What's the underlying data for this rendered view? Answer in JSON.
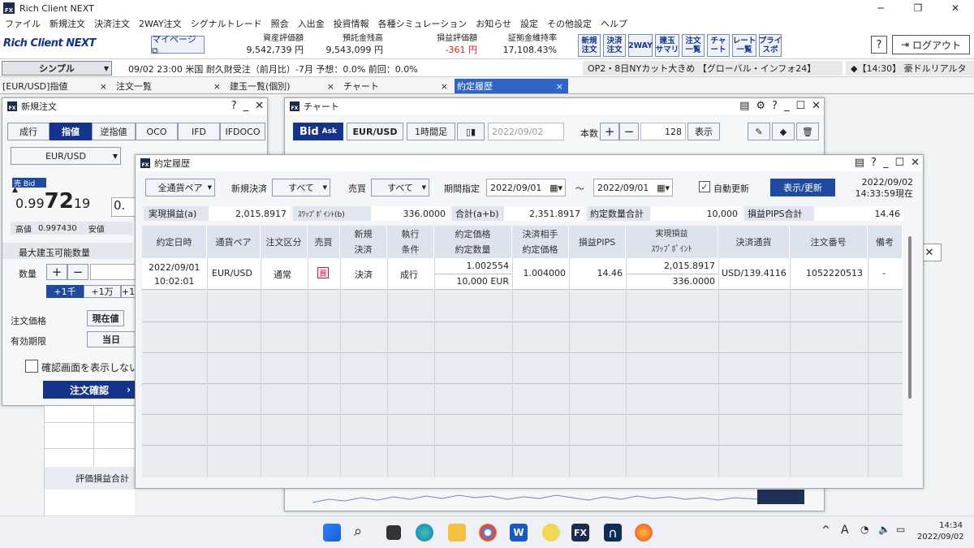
{
  "app": {
    "title": "Rich Client NEXT",
    "fx": "FX"
  },
  "window_controls": {
    "minimize": "─",
    "restore": "❐",
    "close": "✕"
  },
  "menu": [
    "ファイル",
    "新規注文",
    "決済注文",
    "2WAY注文",
    "シグナルトレード",
    "照会",
    "入出金",
    "投資情報",
    "各種シミュレーション",
    "お知らせ",
    "設定",
    "その他設定",
    "ヘルプ"
  ],
  "header": {
    "logo": "Rich Client NEXT",
    "mypage": "マイページ ⧉",
    "stats": [
      {
        "label": "資産評価額",
        "value": "9,542,739 円",
        "color": "#222222"
      },
      {
        "label": "預託金残高",
        "value": "9,543,099 円",
        "color": "#222222"
      },
      {
        "label": "損益評価額",
        "value": "-361 円",
        "color": "#e01b1b"
      },
      {
        "label": "証拠金維持率",
        "value": "17,108.43%",
        "color": "#222222"
      }
    ],
    "tool_buttons": [
      "新規\n注文",
      "決済\n注文",
      "2WAY",
      "建玉\nサマリ",
      "注文\n一覧",
      "チャ\nート",
      "レート\n一覧",
      "プライ\nスボ"
    ],
    "help": "?",
    "logout": "ログアウト"
  },
  "news": {
    "mode": "シンプル",
    "text": "09/02 23:00 米国 耐久財受注（前月比）-7月 予想：0.0% 前回：0.0%",
    "ticker1": "OP2・8日NYカット大きめ 【グローバル・インフォ24】",
    "ticker2": "◆【14:30】 豪ドルリアルタ"
  },
  "tabs": [
    {
      "label": "[EUR/USD]指値",
      "close": "×"
    },
    {
      "label": "注文一覧",
      "close": "×"
    },
    {
      "label": "建玉一覧(個別)",
      "close": "×"
    },
    {
      "label": "チャート",
      "close": "×"
    },
    {
      "label": "約定履歴",
      "close": "×"
    }
  ],
  "new_order": {
    "title": "新規注文",
    "order_types": [
      "成行",
      "指値",
      "逆指値",
      "OCO",
      "IFD",
      "IFDOCO"
    ],
    "pair": "EUR/USD",
    "sell_label": "売 Bid",
    "price_small": "0.99",
    "price_big": "72",
    "price_tail": "19",
    "high_label": "高値",
    "high_value": "0.997430",
    "low_label": "安値",
    "max_label": "最大建玉可能数量",
    "qty_label": "数量",
    "qty_steps": [
      "+1千",
      "+1万",
      "+1"
    ],
    "price_label": "注文価格",
    "price_mode": "現在値",
    "expiry_label": "有効期限",
    "expiry": "当日",
    "confirm_check": "確認画面を表示しない",
    "confirm_button": "注文確認",
    "eval_total": "評価損益合計"
  },
  "chart_win": {
    "title": "チャート",
    "bid": "Bid",
    "ask": "Ask",
    "pair": "EUR/USD",
    "period": "1時間足",
    "date": "2022/09/02",
    "count_label": "本数",
    "count": "128",
    "show": "表示"
  },
  "history": {
    "title": "約定履歴",
    "filter_pair": "全通貨ペア",
    "new_close_label": "新規決済",
    "new_close": "すべて",
    "side_label": "売買",
    "side": "すべて",
    "period_label": "期間指定",
    "date_from": "2022/09/01",
    "tilde": "～",
    "date_to": "2022/09/01",
    "auto_update": "自動更新",
    "refresh": "表示/更新",
    "asof_date": "2022/09/02",
    "asof_time": "14:33:59現在",
    "summary": [
      {
        "label": "実現損益(a)",
        "value": "2,015.8917"
      },
      {
        "label": "ｽﾜｯﾌﾟﾎﾟｲﾝﾄ(b)",
        "value": "336.0000"
      },
      {
        "label": "合計(a+b)",
        "value": "2,351.8917"
      },
      {
        "label": "約定数量合計",
        "value": "10,000"
      },
      {
        "label": "損益PIPS合計",
        "value": "14.46"
      }
    ],
    "columns": [
      "約定日時",
      "通貨ペア",
      "注文区分",
      "売買",
      "新規\n決済",
      "執行\n条件",
      "約定価格\n約定数量",
      "決済相手\n約定価格",
      "損益PIPS",
      "実現損益\nｽﾜｯﾌﾟﾎﾟｲﾝﾄ",
      "決済通貨",
      "注文番号",
      "備考"
    ],
    "row": {
      "date": "2022/09/01",
      "time": "10:02:01",
      "pair": "EUR/USD",
      "order_type": "通常",
      "side": "買",
      "new_close": "決済",
      "exec": "成行",
      "price": "1.002554",
      "qty": "10,000 EUR",
      "counter_price": "1.004000",
      "pips": "14.46",
      "pnl": "2,015.8917",
      "swap": "336.0000",
      "currency": "USD/139.4116",
      "order_no": "1052220513",
      "note": "-"
    }
  },
  "taskbar": {
    "time": "14:34",
    "date": "2022/09/02",
    "ime": "A"
  }
}
